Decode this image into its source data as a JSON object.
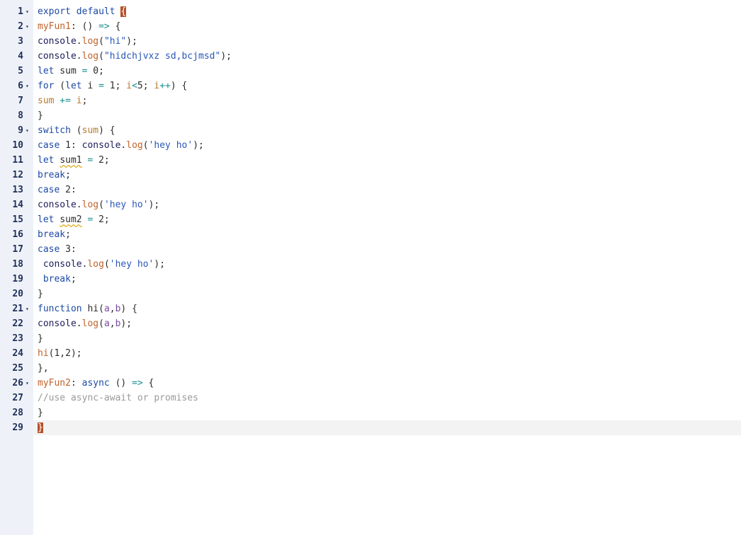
{
  "editor": {
    "lines": [
      {
        "n": "1",
        "fold": true,
        "tokens": [
          {
            "t": "export default ",
            "c": "kw"
          },
          {
            "t": "{",
            "c": "brace-hl"
          }
        ]
      },
      {
        "n": "2",
        "fold": true,
        "tokens": [
          {
            "t": "myFun1",
            "c": "fn"
          },
          {
            "t": ": () ",
            "c": "id"
          },
          {
            "t": "=>",
            "c": "op"
          },
          {
            "t": " {",
            "c": "id"
          }
        ]
      },
      {
        "n": "3",
        "fold": false,
        "tokens": [
          {
            "t": "console",
            "c": "obj"
          },
          {
            "t": ".",
            "c": "id"
          },
          {
            "t": "log",
            "c": "fn"
          },
          {
            "t": "(",
            "c": "id"
          },
          {
            "t": "\"hi\"",
            "c": "str"
          },
          {
            "t": ");",
            "c": "id"
          }
        ]
      },
      {
        "n": "4",
        "fold": false,
        "tokens": [
          {
            "t": "console",
            "c": "obj"
          },
          {
            "t": ".",
            "c": "id"
          },
          {
            "t": "log",
            "c": "fn"
          },
          {
            "t": "(",
            "c": "id"
          },
          {
            "t": "\"hidchjvxz sd,bcjmsd\"",
            "c": "str"
          },
          {
            "t": ");",
            "c": "id"
          }
        ]
      },
      {
        "n": "5",
        "fold": false,
        "tokens": [
          {
            "t": "let",
            "c": "kw"
          },
          {
            "t": " sum ",
            "c": "id"
          },
          {
            "t": "=",
            "c": "op"
          },
          {
            "t": " 0;",
            "c": "id"
          }
        ]
      },
      {
        "n": "6",
        "fold": true,
        "tokens": [
          {
            "t": "for",
            "c": "kw"
          },
          {
            "t": " (",
            "c": "id"
          },
          {
            "t": "let",
            "c": "kw"
          },
          {
            "t": " i ",
            "c": "id"
          },
          {
            "t": "=",
            "c": "op"
          },
          {
            "t": " 1; ",
            "c": "id"
          },
          {
            "t": "i",
            "c": "var"
          },
          {
            "t": "<",
            "c": "op"
          },
          {
            "t": "5; ",
            "c": "id"
          },
          {
            "t": "i",
            "c": "var"
          },
          {
            "t": "++",
            "c": "op"
          },
          {
            "t": ") {",
            "c": "id"
          }
        ]
      },
      {
        "n": "7",
        "fold": false,
        "tokens": [
          {
            "t": "sum",
            "c": "var"
          },
          {
            "t": " += ",
            "c": "op"
          },
          {
            "t": "i",
            "c": "var"
          },
          {
            "t": ";",
            "c": "id"
          }
        ]
      },
      {
        "n": "8",
        "fold": false,
        "tokens": [
          {
            "t": "}",
            "c": "id"
          }
        ]
      },
      {
        "n": "9",
        "fold": true,
        "tokens": [
          {
            "t": "switch",
            "c": "kw"
          },
          {
            "t": " (",
            "c": "id"
          },
          {
            "t": "sum",
            "c": "var"
          },
          {
            "t": ") {",
            "c": "id"
          }
        ]
      },
      {
        "n": "10",
        "fold": false,
        "tokens": [
          {
            "t": "case",
            "c": "kw"
          },
          {
            "t": " 1: ",
            "c": "id"
          },
          {
            "t": "console",
            "c": "obj"
          },
          {
            "t": ".",
            "c": "id"
          },
          {
            "t": "log",
            "c": "fn"
          },
          {
            "t": "(",
            "c": "id"
          },
          {
            "t": "'hey ho'",
            "c": "str"
          },
          {
            "t": ");",
            "c": "id"
          }
        ]
      },
      {
        "n": "11",
        "fold": false,
        "tokens": [
          {
            "t": "let",
            "c": "kw"
          },
          {
            "t": " ",
            "c": "id"
          },
          {
            "t": "sum1",
            "c": "warn"
          },
          {
            "t": " ",
            "c": "id"
          },
          {
            "t": "=",
            "c": "op"
          },
          {
            "t": " 2;",
            "c": "id"
          }
        ]
      },
      {
        "n": "12",
        "fold": false,
        "tokens": [
          {
            "t": "break",
            "c": "kw"
          },
          {
            "t": ";",
            "c": "id"
          }
        ]
      },
      {
        "n": "13",
        "fold": false,
        "tokens": [
          {
            "t": "case",
            "c": "kw"
          },
          {
            "t": " 2:",
            "c": "id"
          }
        ]
      },
      {
        "n": "14",
        "fold": false,
        "tokens": [
          {
            "t": "console",
            "c": "obj"
          },
          {
            "t": ".",
            "c": "id"
          },
          {
            "t": "log",
            "c": "fn"
          },
          {
            "t": "(",
            "c": "id"
          },
          {
            "t": "'hey ho'",
            "c": "str"
          },
          {
            "t": ");",
            "c": "id"
          }
        ]
      },
      {
        "n": "15",
        "fold": false,
        "tokens": [
          {
            "t": "let",
            "c": "kw"
          },
          {
            "t": " ",
            "c": "id"
          },
          {
            "t": "sum2",
            "c": "warn"
          },
          {
            "t": " ",
            "c": "id"
          },
          {
            "t": "=",
            "c": "op"
          },
          {
            "t": " 2;",
            "c": "id"
          }
        ]
      },
      {
        "n": "16",
        "fold": false,
        "tokens": [
          {
            "t": "break",
            "c": "kw"
          },
          {
            "t": ";",
            "c": "id"
          }
        ]
      },
      {
        "n": "17",
        "fold": false,
        "tokens": [
          {
            "t": "case",
            "c": "kw"
          },
          {
            "t": " 3:",
            "c": "id"
          }
        ]
      },
      {
        "n": "18",
        "fold": false,
        "tokens": [
          {
            "t": " ",
            "c": "id"
          },
          {
            "t": "console",
            "c": "obj"
          },
          {
            "t": ".",
            "c": "id"
          },
          {
            "t": "log",
            "c": "fn"
          },
          {
            "t": "(",
            "c": "id"
          },
          {
            "t": "'hey ho'",
            "c": "str"
          },
          {
            "t": ");",
            "c": "id"
          }
        ]
      },
      {
        "n": "19",
        "fold": false,
        "tokens": [
          {
            "t": " ",
            "c": "id"
          },
          {
            "t": "break",
            "c": "kw"
          },
          {
            "t": ";",
            "c": "id"
          }
        ]
      },
      {
        "n": "20",
        "fold": false,
        "tokens": [
          {
            "t": "}",
            "c": "id"
          }
        ]
      },
      {
        "n": "21",
        "fold": true,
        "tokens": [
          {
            "t": "function",
            "c": "kw"
          },
          {
            "t": " hi",
            "c": "id"
          },
          {
            "t": "(",
            "c": "id"
          },
          {
            "t": "a",
            "c": "param"
          },
          {
            "t": ",",
            "c": "id"
          },
          {
            "t": "b",
            "c": "param"
          },
          {
            "t": ") {",
            "c": "id"
          }
        ]
      },
      {
        "n": "22",
        "fold": false,
        "tokens": [
          {
            "t": "console",
            "c": "obj"
          },
          {
            "t": ".",
            "c": "id"
          },
          {
            "t": "log",
            "c": "fn"
          },
          {
            "t": "(",
            "c": "id"
          },
          {
            "t": "a",
            "c": "param"
          },
          {
            "t": ",",
            "c": "id"
          },
          {
            "t": "b",
            "c": "param"
          },
          {
            "t": ");",
            "c": "id"
          }
        ]
      },
      {
        "n": "23",
        "fold": false,
        "tokens": [
          {
            "t": "}",
            "c": "id"
          }
        ]
      },
      {
        "n": "24",
        "fold": false,
        "tokens": [
          {
            "t": "hi",
            "c": "fn"
          },
          {
            "t": "(1,2);",
            "c": "id"
          }
        ]
      },
      {
        "n": "25",
        "fold": false,
        "tokens": [
          {
            "t": "},",
            "c": "id"
          }
        ]
      },
      {
        "n": "26",
        "fold": true,
        "tokens": [
          {
            "t": "myFun2",
            "c": "fn"
          },
          {
            "t": ": ",
            "c": "id"
          },
          {
            "t": "async",
            "c": "kw"
          },
          {
            "t": " () ",
            "c": "id"
          },
          {
            "t": "=>",
            "c": "op"
          },
          {
            "t": " {",
            "c": "id"
          }
        ]
      },
      {
        "n": "27",
        "fold": false,
        "tokens": [
          {
            "t": "//use async-await or promises",
            "c": "com"
          }
        ]
      },
      {
        "n": "28",
        "fold": false,
        "tokens": [
          {
            "t": "}",
            "c": "id"
          }
        ]
      },
      {
        "n": "29",
        "fold": false,
        "active": true,
        "tokens": [
          {
            "t": "}",
            "c": "brace-hl"
          }
        ]
      }
    ],
    "fold_icon": "▾",
    "colors": {
      "gutter_bg": "#eef2f8",
      "line_number": "#1f2f5a",
      "keyword": "#1d4aa6",
      "function": "#c0622a",
      "string": "#2a58b8",
      "operator": "#1a8f8f",
      "variable": "#b87a2c",
      "comment": "#9a9a9a",
      "bracket_match_bg": "#b5522c",
      "active_line_bg": "#f3f3f3"
    }
  }
}
